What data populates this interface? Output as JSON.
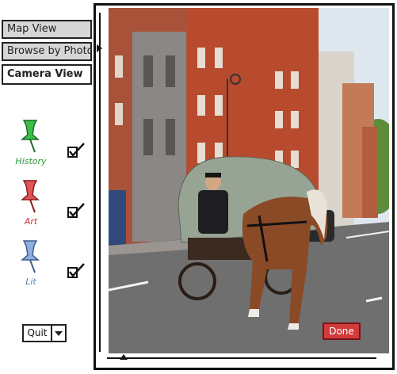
{
  "nav": {
    "tabs": [
      {
        "label": "Map View",
        "active": false
      },
      {
        "label": "Browse by Photos",
        "active": false
      },
      {
        "label": "Camera View",
        "active": true
      }
    ]
  },
  "categories": [
    {
      "label": "History",
      "color": "#2e9b3a",
      "checked": true,
      "icon": "pushpin-icon"
    },
    {
      "label": "Art",
      "color": "#d23232",
      "checked": true,
      "icon": "pushpin-icon"
    },
    {
      "label": "Lit",
      "color": "#5b7fb5",
      "checked": true,
      "icon": "pushpin-icon"
    }
  ],
  "quit": {
    "label": "Quit",
    "icon": "chevron-down-icon"
  },
  "camera": {
    "done_label": "Done",
    "done_color": "#d13b3b",
    "scene": "street photo: horse-drawn covered cart on a city road lined with red-brick buildings"
  }
}
